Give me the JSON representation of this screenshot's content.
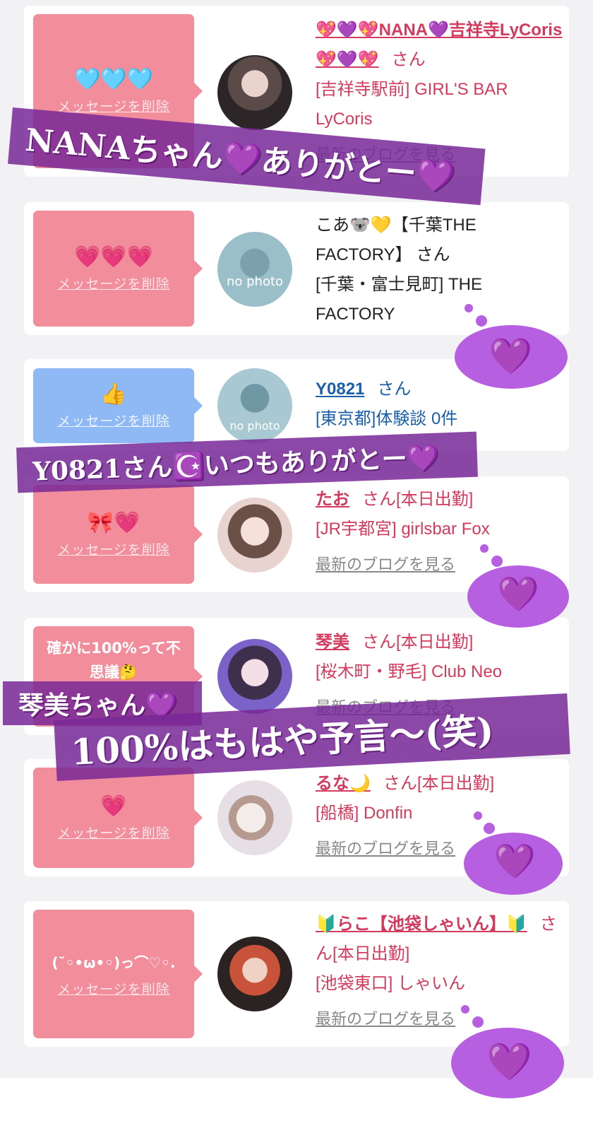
{
  "delete_label": "メッセージを削除",
  "blog_label": "最新のブログを見る",
  "san": "さん",
  "accent": {
    "pink_bubble": "#f28d9b",
    "blue_bubble": "#8fb9f4",
    "name_pink": "#d23a5e",
    "name_blue": "#1a5fa8",
    "banner_purple": "#7a2896",
    "heart_purple": "#b65fe0"
  },
  "cards": [
    {
      "message": "🩵🩵🩵",
      "name": "💖💜💖NANA💜吉祥寺LyCoris💖💜💖",
      "status": "",
      "shop": "[吉祥寺駅前] GIRL'S BAR LyCoris",
      "has_blog": true,
      "avatar": "photo"
    },
    {
      "message": "💗💗💗",
      "name": "こあ🐨💛【千葉THE FACTORY】",
      "status": "",
      "shop": "[千葉・富士見町] THE FACTORY",
      "has_blog": false,
      "avatar": "no photo"
    },
    {
      "message": "👍",
      "name": "Y0821",
      "status": "",
      "shop": "[東京都]体験談 0件",
      "has_blog": false,
      "avatar": "no photo"
    },
    {
      "message": "🎀💗",
      "name": "たお",
      "status": "[本日出勤]",
      "shop": "[JR宇都宮] girlsbar Fox",
      "has_blog": true,
      "avatar": "photo"
    },
    {
      "message": "確かに100%って不思議🤔",
      "name": "琴美",
      "status": "[本日出勤]",
      "shop": "[桜木町・野毛] Club Neo",
      "has_blog": true,
      "avatar": "photo"
    },
    {
      "message": "💗",
      "name": "るな🌙",
      "status": "[本日出勤]",
      "shop": "[船橋] Donfin",
      "has_blog": true,
      "avatar": "photo"
    },
    {
      "message": "(˘◦•ω•◦)っ⌒♡◦.",
      "name": "🔰らこ【池袋しゃいん】🔰",
      "status": "[本日出勤]",
      "shop": "[池袋東口] しゃいん",
      "has_blog": true,
      "avatar": "photo"
    }
  ],
  "banners": [
    "NANAちゃん💜ありがとー💜",
    "Y0821さん☪️いつもありがとー💜",
    "琴美ちゃん💜",
    "100%はもはや予言〜(笑)"
  ],
  "cloud_heart": "💜"
}
